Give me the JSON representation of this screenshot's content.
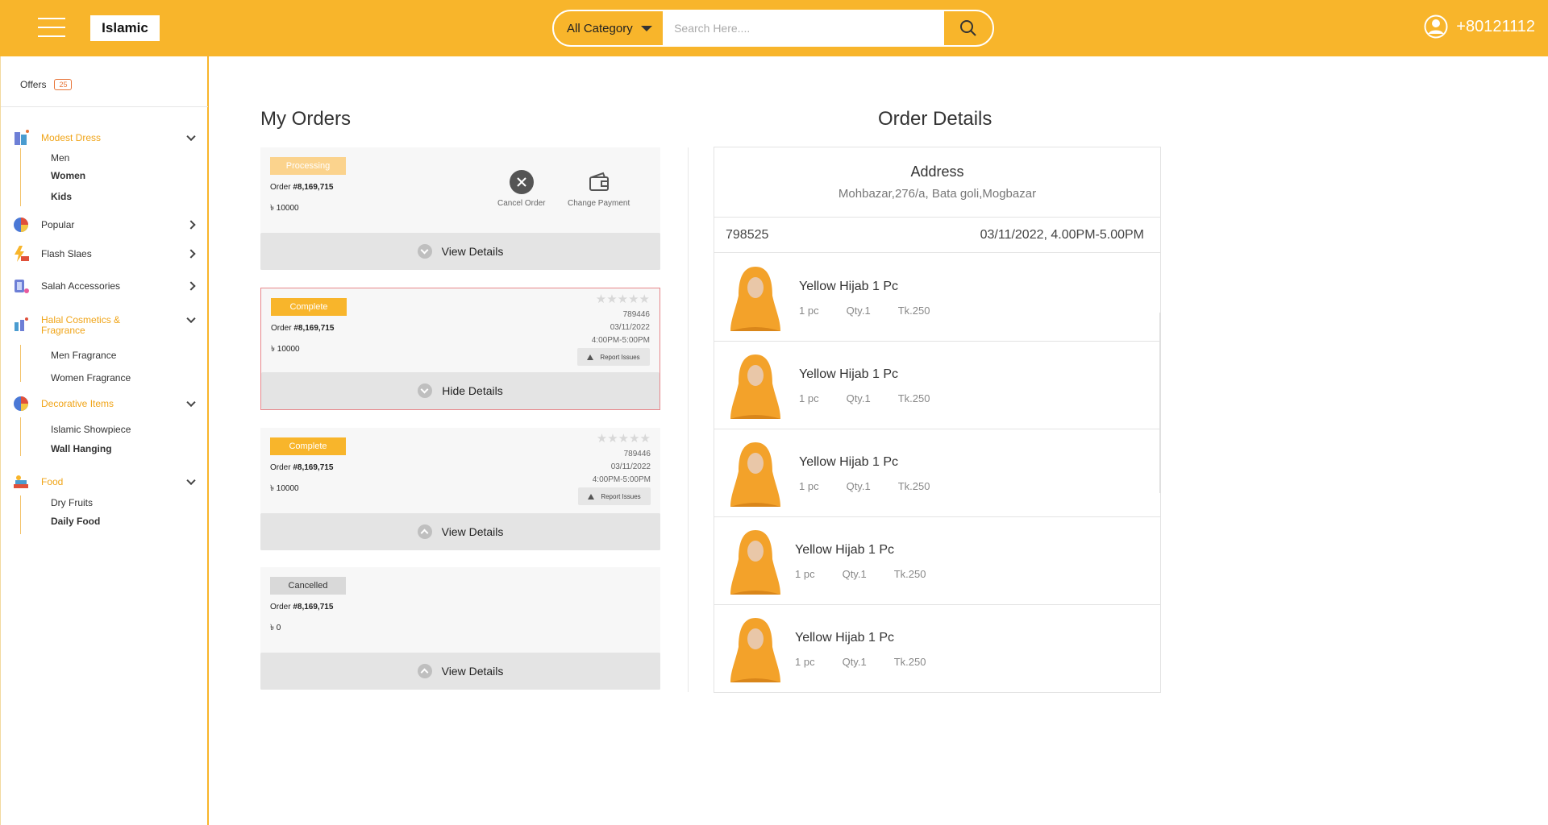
{
  "header": {
    "logo": "Islamic",
    "category_select": "All Category",
    "search_placeholder": "Search Here....",
    "phone": "+80121112"
  },
  "sidebar": {
    "offers_label": "Offers",
    "offers_count": "25",
    "categories": [
      {
        "label": "Modest Dress",
        "icon": "dress-icon",
        "subs": [
          "Men",
          "Women",
          "Kids"
        ]
      },
      {
        "label": "Popular",
        "icon": "popular-icon"
      },
      {
        "label": "Flash Slaes",
        "icon": "flash-sale-icon"
      },
      {
        "label": "Salah Accessories",
        "icon": "prayer-icon"
      },
      {
        "label": "Halal Cosmetics & Fragrance",
        "icon": "cosmetics-icon",
        "subs": [
          "Men Fragrance",
          "Women Fragrance"
        ]
      },
      {
        "label": "Decorative Items",
        "icon": "decor-icon",
        "subs": [
          "Islamic Showpiece",
          "Wall Hanging"
        ]
      },
      {
        "label": "Food",
        "icon": "food-icon",
        "subs": [
          "Dry Fruits",
          "Daily Food"
        ]
      }
    ]
  },
  "orders": {
    "title": "My Orders",
    "order_prefix": "Order ",
    "currency": "৳",
    "actions": {
      "cancel": "Cancel Order",
      "change_payment": "Change Payment",
      "report": "Report Issues"
    },
    "list": [
      {
        "status": "Processing",
        "number": "#8,169,715",
        "amount": "10000",
        "button": "View Details"
      },
      {
        "status": "Complete",
        "number": "#8,169,715",
        "amount": "10000",
        "id": "789446",
        "date": "03/11/2022",
        "time": "4:00PM-5:00PM",
        "rating": 0,
        "button": "Hide Details"
      },
      {
        "status": "Complete",
        "number": "#8,169,715",
        "amount": "10000",
        "id": "789446",
        "date": "03/11/2022",
        "time": "4:00PM-5:00PM",
        "rating": 0,
        "button": "View Details"
      },
      {
        "status": "Cancelled",
        "number": "#8,169,715",
        "amount": "0",
        "button": "View Details"
      }
    ]
  },
  "details": {
    "title": "Order Details",
    "address_label": "Address",
    "address": "Mohbazar,276/a, Bata goli,Mogbazar",
    "order_id": "798525",
    "datetime": "03/11/2022, 4.00PM-5.00PM",
    "items": [
      {
        "name": "Yellow Hijab 1 Pc",
        "unit": "1 pc",
        "qty": "Qty.1",
        "price": "Tk.250"
      },
      {
        "name": "Yellow Hijab 1 Pc",
        "unit": "1 pc",
        "qty": "Qty.1",
        "price": "Tk.250"
      },
      {
        "name": "Yellow Hijab 1 Pc",
        "unit": "1 pc",
        "qty": "Qty.1",
        "price": "Tk.250"
      },
      {
        "name": "Yellow Hijab 1 Pc",
        "unit": "1 pc",
        "qty": "Qty.1",
        "price": "Tk.250"
      },
      {
        "name": "Yellow Hijab 1 Pc",
        "unit": "1 pc",
        "qty": "Qty.1",
        "price": "Tk.250"
      }
    ]
  },
  "colors": {
    "brand": "#f8b52b",
    "accent": "#f0a417",
    "alert_border": "#e7868a",
    "offers_badge": "#e8763a"
  }
}
